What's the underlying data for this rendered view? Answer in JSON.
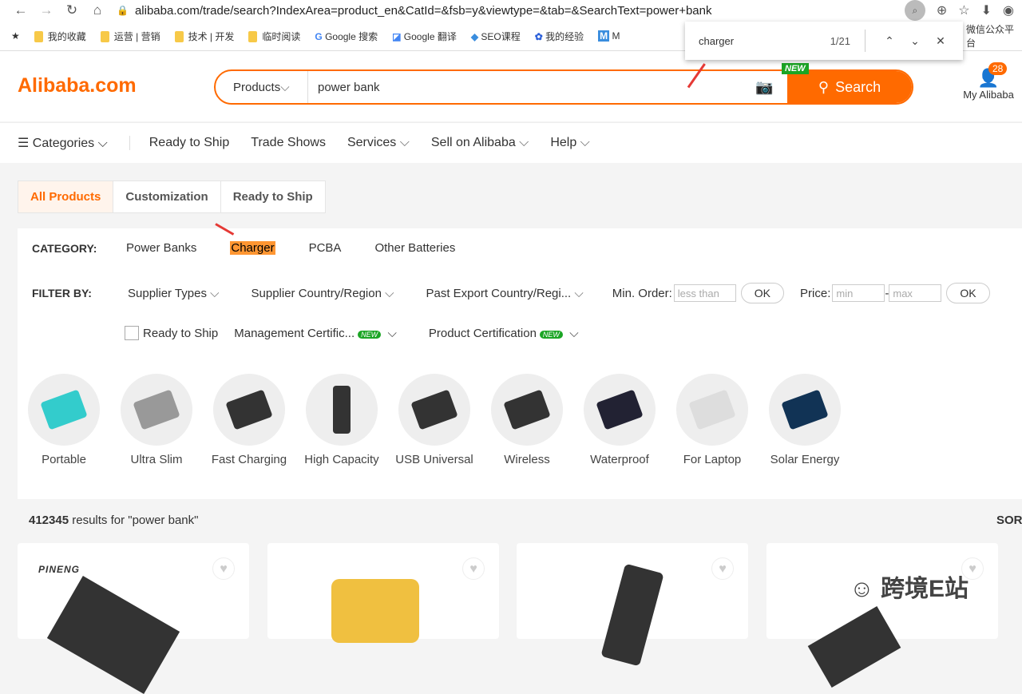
{
  "browser": {
    "url": "alibaba.com/trade/search?IndexArea=product_en&CatId=&fsb=y&viewtype=&tab=&SearchText=power+bank",
    "bookmarks": [
      "我的收藏",
      "运营 | 营销",
      "技术 | 开发",
      "临时阅读",
      "Google 搜索",
      "Google 翻译",
      "SEO课程",
      "我的经验",
      "M",
      "微信公众平台"
    ]
  },
  "find": {
    "query": "charger",
    "count": "1/21"
  },
  "header": {
    "logo": "Alibaba.com",
    "search_category": "Products",
    "search_value": "power bank",
    "search_button": "Search",
    "new_tag": "NEW",
    "my_label": "My Alibaba",
    "badge": "28"
  },
  "menu": [
    "Categories",
    "Ready to Ship",
    "Trade Shows",
    "Services",
    "Sell on Alibaba",
    "Help"
  ],
  "tabs": [
    "All Products",
    "Customization",
    "Ready to Ship"
  ],
  "category": {
    "label": "CATEGORY:",
    "items": [
      "Power Banks",
      "Charger",
      "PCBA",
      "Other Batteries"
    ]
  },
  "filter": {
    "label": "FILTER BY:",
    "supplier_types": "Supplier Types",
    "supplier_country": "Supplier Country/Region",
    "past_export": "Past Export Country/Regi...",
    "min_order": "Min. Order:",
    "min_order_placeholder": "less than",
    "ok": "OK",
    "price": "Price:",
    "price_min": "min",
    "price_max": "max",
    "ready_to_ship": "Ready to Ship",
    "mgmt_cert": "Management Certific...",
    "product_cert": "Product Certification",
    "new": "NEW"
  },
  "subcategories": [
    "Portable",
    "Ultra Slim",
    "Fast Charging",
    "High Capacity",
    "USB Universal",
    "Wireless",
    "Waterproof",
    "For Laptop",
    "Solar Energy"
  ],
  "results": {
    "count": "412345",
    "text": " results for \"power bank\"",
    "sort": "SORT"
  },
  "products": [
    {
      "brand": "PINENG"
    },
    {
      "brand": ""
    },
    {
      "brand": ""
    },
    {
      "brand": ""
    }
  ],
  "watermark": "跨境E站"
}
